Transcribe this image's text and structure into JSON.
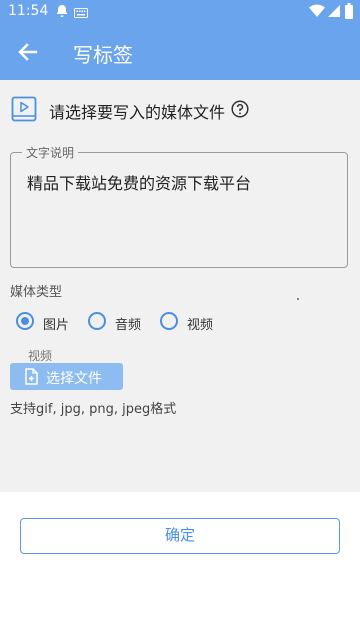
{
  "status_bar": {
    "time": "11:54",
    "icons": [
      "notification-icon",
      "keyboard-icon",
      "wifi-icon",
      "signal-icon",
      "battery-icon"
    ]
  },
  "app_bar": {
    "title": "写标签",
    "back_icon": "arrow-left-icon",
    "background": "#6aa4ec"
  },
  "hint": {
    "icon": "media-file-icon",
    "text": "请选择要写入的媒体文件",
    "help_icon": "question-circle-icon"
  },
  "text_field": {
    "label": "文字说明",
    "value": "精品下载站免费的资源下载平台"
  },
  "media_type": {
    "label": "媒体类型",
    "options": [
      {
        "label": "图片",
        "checked": true
      },
      {
        "label": "音频",
        "checked": false
      },
      {
        "label": "视频",
        "checked": false
      }
    ]
  },
  "file_section": {
    "label": "视频",
    "button_label": "选择文件",
    "button_icon": "file-add-icon",
    "support_text": "支持gif, jpg, png, jpeg格式"
  },
  "confirm_button": {
    "label": "确定"
  },
  "colors": {
    "accent": "#4a8fe0",
    "button_fill": "#8cbcf0",
    "content_bg": "#f1f1f1"
  }
}
